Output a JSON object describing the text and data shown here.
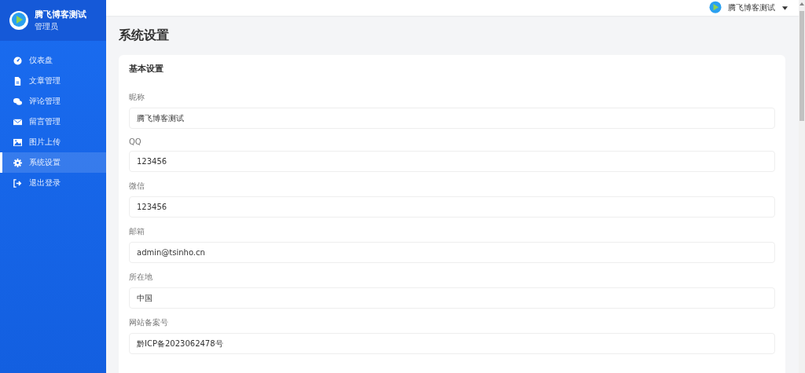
{
  "sidebar": {
    "brand": {
      "title": "腾飞博客测试",
      "subtitle": "管理员"
    },
    "items": [
      {
        "label": "仪表盘",
        "selected": false
      },
      {
        "label": "文章管理",
        "selected": false
      },
      {
        "label": "评论管理",
        "selected": false
      },
      {
        "label": "留言管理",
        "selected": false
      },
      {
        "label": "图片上传",
        "selected": false
      },
      {
        "label": "系统设置",
        "selected": true
      },
      {
        "label": "退出登录",
        "selected": false
      }
    ]
  },
  "header": {
    "user": "腾飞博客测试"
  },
  "page_title": "系统设置",
  "card": {
    "title": "基本设置",
    "fields": [
      {
        "label": "昵称",
        "value": "腾飞博客测试"
      },
      {
        "label": "QQ",
        "value": "123456"
      },
      {
        "label": "微信",
        "value": "123456"
      },
      {
        "label": "邮箱",
        "value": "admin@tsinho.cn"
      },
      {
        "label": "所在地",
        "value": "中国"
      },
      {
        "label": "网站备案号",
        "value": "黔ICP备2023062478号"
      }
    ]
  }
}
